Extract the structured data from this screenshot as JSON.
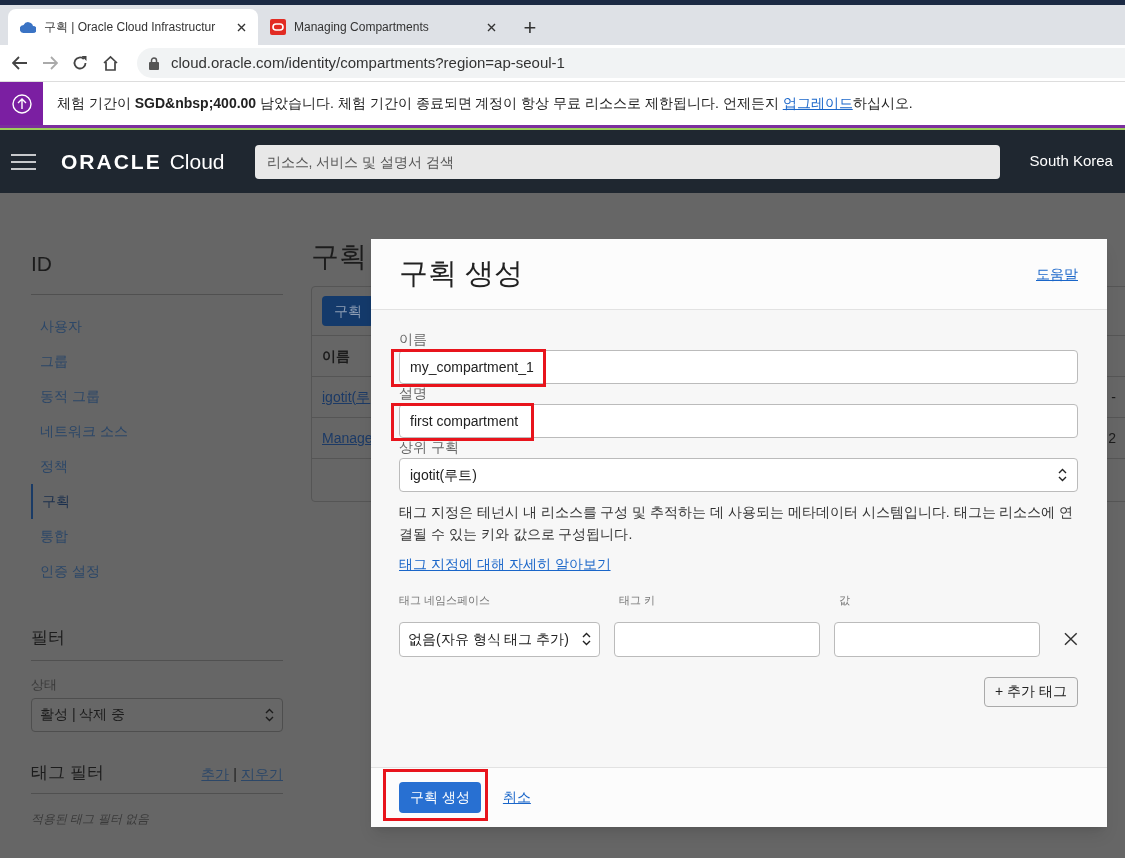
{
  "browser": {
    "tabs": [
      {
        "title": "구획 | Oracle Cloud Infrastructur",
        "selected": true
      },
      {
        "title": "Managing Compartments",
        "selected": false
      }
    ],
    "new_tab": "+",
    "address": "cloud.oracle.com/identity/compartments?region=ap-seoul-1"
  },
  "banner": {
    "text": "체험 기간이 **SGD&nbsp;400.00** 남았습니다. 체험 기간이 종료되면 계정이 항상 무료 리소스로 제한됩니다. 언제든지 ",
    "link": "업그레이드",
    "text_after": "하십시오."
  },
  "navbar": {
    "logo_word": "ORACLE",
    "logo_product": "Cloud",
    "search_placeholder": "리소스, 서비스 및 설명서 검색",
    "region": "South Korea"
  },
  "sidebar": {
    "title": "ID",
    "items": [
      {
        "label": "사용자",
        "selected": false
      },
      {
        "label": "그룹",
        "selected": false
      },
      {
        "label": "동적 그룹",
        "selected": false
      },
      {
        "label": "네트워크 소스",
        "selected": false
      },
      {
        "label": "정책",
        "selected": false
      },
      {
        "label": "구획",
        "selected": true
      },
      {
        "label": "통합",
        "selected": false
      },
      {
        "label": "인증 설정",
        "selected": false
      }
    ],
    "filter_title": "필터",
    "state_label": "상태",
    "state_value": "활성 | 삭제 중",
    "tag_filter_title": "태그 필터",
    "tag_add": "추가",
    "tag_separator": "|",
    "tag_clear": "지우기",
    "tag_empty": "적용된 태그 필터 없음"
  },
  "main": {
    "title": "구획",
    "create_button": "구획",
    "table": {
      "columns": [
        "이름"
      ],
      "rows": [
        {
          "name": "igotit(루",
          "column_3": "-"
        },
        {
          "name": "Manage",
          "column_3": "2"
        }
      ]
    }
  },
  "modal": {
    "title": "구획 생성",
    "help": "도움말",
    "fields": [
      {
        "kind": "text",
        "label": "이름",
        "value": "my_compartment_1",
        "highlighted": true
      },
      {
        "kind": "text",
        "label": "설명",
        "value": "first compartment",
        "highlighted": true
      },
      {
        "kind": "select",
        "label": "상위 구획",
        "value": "igotit(루트)"
      }
    ],
    "tag_info": "태그 지정은 테넌시 내 리소스를 구성 및 추적하는 데 사용되는 메타데이터 시스템입니다. 태그는 리소스에 연결될 수 있는 키와 값으로 구성됩니다.",
    "tag_link": "태그 지정에 대해 자세히 알아보기",
    "tag_columns": [
      "태그 네임스페이스",
      "태그 키",
      "값"
    ],
    "tag_row": {
      "namespace": "없음(자유 형식 태그 추가)"
    },
    "add_tag": "+ 추가 태그",
    "submit": {
      "label": "구획 생성",
      "highlighted": true
    },
    "cancel": "취소"
  }
}
